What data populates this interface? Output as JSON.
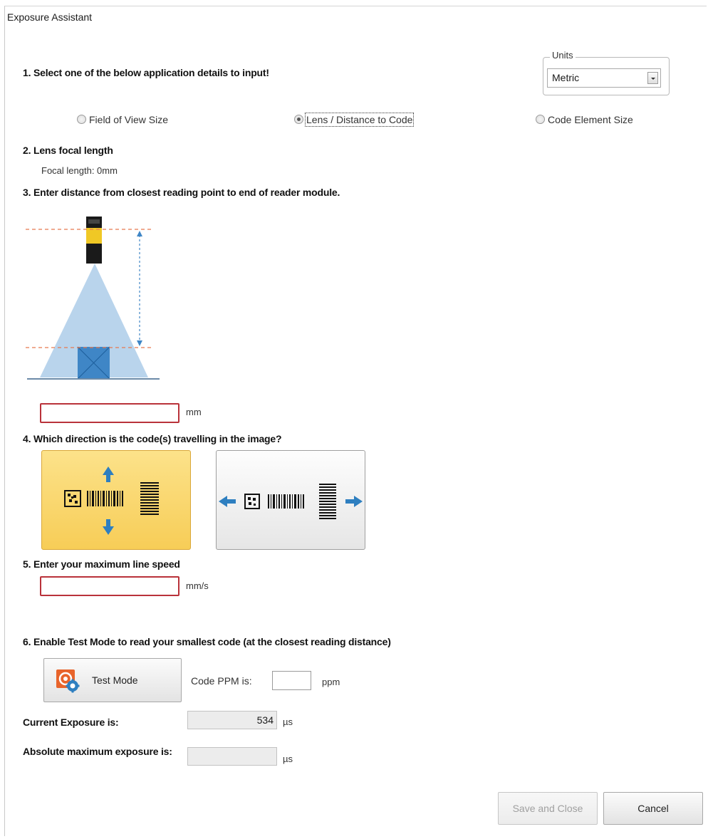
{
  "window": {
    "title": "Exposure Assistant"
  },
  "step1": {
    "label": "1. Select one of the below application details to input!",
    "options": [
      "Field of View Size",
      "Lens / Distance to Code",
      "Code Element Size"
    ],
    "selected_index": 1
  },
  "units": {
    "legend": "Units",
    "selected": "Metric",
    "dropdown_icon": "chevron-down-icon"
  },
  "step2": {
    "label": "2. Lens focal length",
    "focal_length_text": "Focal length: 0mm"
  },
  "step3": {
    "label": "3. Enter distance from closest reading point to end of reader module.",
    "distance_value": "",
    "unit": "mm"
  },
  "step4": {
    "label": "4. Which direction is the code(s) travelling in the image?",
    "options": [
      "vertical",
      "horizontal"
    ],
    "selected": "vertical"
  },
  "step5": {
    "label": "5. Enter your maximum line speed",
    "speed_value": "",
    "unit": "mm/s"
  },
  "step6": {
    "label": "6. Enable Test Mode to read your smallest code (at the closest reading distance)",
    "test_mode_label": "Test Mode",
    "ppm_label": "Code PPM is:",
    "ppm_value": "",
    "ppm_unit": "ppm"
  },
  "exposure": {
    "current_label": "Current Exposure is:",
    "current_value": "534",
    "current_unit": "µs",
    "max_label": "Absolute maximum exposure is:",
    "max_value": "",
    "max_unit": "µs"
  },
  "footer": {
    "save_label": "Save and Close",
    "cancel_label": "Cancel"
  },
  "colors": {
    "accent_yellow": "#f7cd57",
    "error_red": "#b9323a",
    "arrow_blue": "#2e7fc0"
  }
}
